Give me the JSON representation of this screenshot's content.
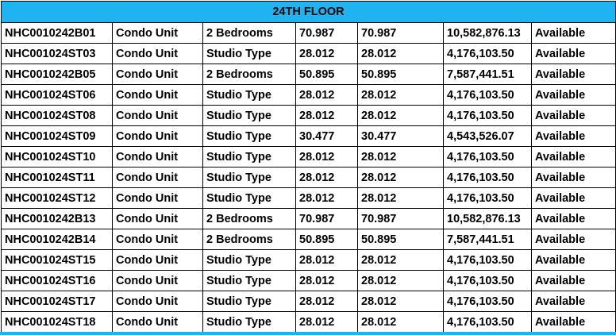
{
  "floor_header": "24TH FLOOR",
  "header_color": "#1fb4f0",
  "rows": [
    {
      "code": "NHC0010242B01",
      "category": "Condo Unit",
      "type": "2 Bedrooms",
      "area_a": "70.987",
      "area_b": "70.987",
      "price": "10,582,876.13",
      "status": "Available"
    },
    {
      "code": "NHC001024ST03",
      "category": "Condo Unit",
      "type": "Studio Type",
      "area_a": "28.012",
      "area_b": "28.012",
      "price": "4,176,103.50",
      "status": "Available"
    },
    {
      "code": "NHC0010242B05",
      "category": "Condo Unit",
      "type": "2 Bedrooms",
      "area_a": "50.895",
      "area_b": "50.895",
      "price": "7,587,441.51",
      "status": "Available"
    },
    {
      "code": "NHC001024ST06",
      "category": "Condo Unit",
      "type": "Studio Type",
      "area_a": "28.012",
      "area_b": "28.012",
      "price": "4,176,103.50",
      "status": "Available"
    },
    {
      "code": "NHC001024ST08",
      "category": "Condo Unit",
      "type": "Studio Type",
      "area_a": "28.012",
      "area_b": "28.012",
      "price": "4,176,103.50",
      "status": "Available"
    },
    {
      "code": "NHC001024ST09",
      "category": "Condo Unit",
      "type": "Studio Type",
      "area_a": "30.477",
      "area_b": "30.477",
      "price": "4,543,526.07",
      "status": "Available"
    },
    {
      "code": "NHC001024ST10",
      "category": "Condo Unit",
      "type": "Studio Type",
      "area_a": "28.012",
      "area_b": "28.012",
      "price": "4,176,103.50",
      "status": "Available"
    },
    {
      "code": "NHC001024ST11",
      "category": "Condo Unit",
      "type": "Studio Type",
      "area_a": "28.012",
      "area_b": "28.012",
      "price": "4,176,103.50",
      "status": "Available"
    },
    {
      "code": "NHC001024ST12",
      "category": "Condo Unit",
      "type": "Studio Type",
      "area_a": "28.012",
      "area_b": "28.012",
      "price": "4,176,103.50",
      "status": "Available"
    },
    {
      "code": "NHC0010242B13",
      "category": "Condo Unit",
      "type": "2 Bedrooms",
      "area_a": "70.987",
      "area_b": "70.987",
      "price": "10,582,876.13",
      "status": "Available"
    },
    {
      "code": "NHC0010242B14",
      "category": "Condo Unit",
      "type": "2 Bedrooms",
      "area_a": "50.895",
      "area_b": "50.895",
      "price": "7,587,441.51",
      "status": "Available"
    },
    {
      "code": "NHC001024ST15",
      "category": "Condo Unit",
      "type": "Studio Type",
      "area_a": "28.012",
      "area_b": "28.012",
      "price": "4,176,103.50",
      "status": "Available"
    },
    {
      "code": "NHC001024ST16",
      "category": "Condo Unit",
      "type": "Studio Type",
      "area_a": "28.012",
      "area_b": "28.012",
      "price": "4,176,103.50",
      "status": "Available"
    },
    {
      "code": "NHC001024ST17",
      "category": "Condo Unit",
      "type": "Studio Type",
      "area_a": "28.012",
      "area_b": "28.012",
      "price": "4,176,103.50",
      "status": "Available"
    },
    {
      "code": "NHC001024ST18",
      "category": "Condo Unit",
      "type": "Studio Type",
      "area_a": "28.012",
      "area_b": "28.012",
      "price": "4,176,103.50",
      "status": "Available"
    }
  ]
}
